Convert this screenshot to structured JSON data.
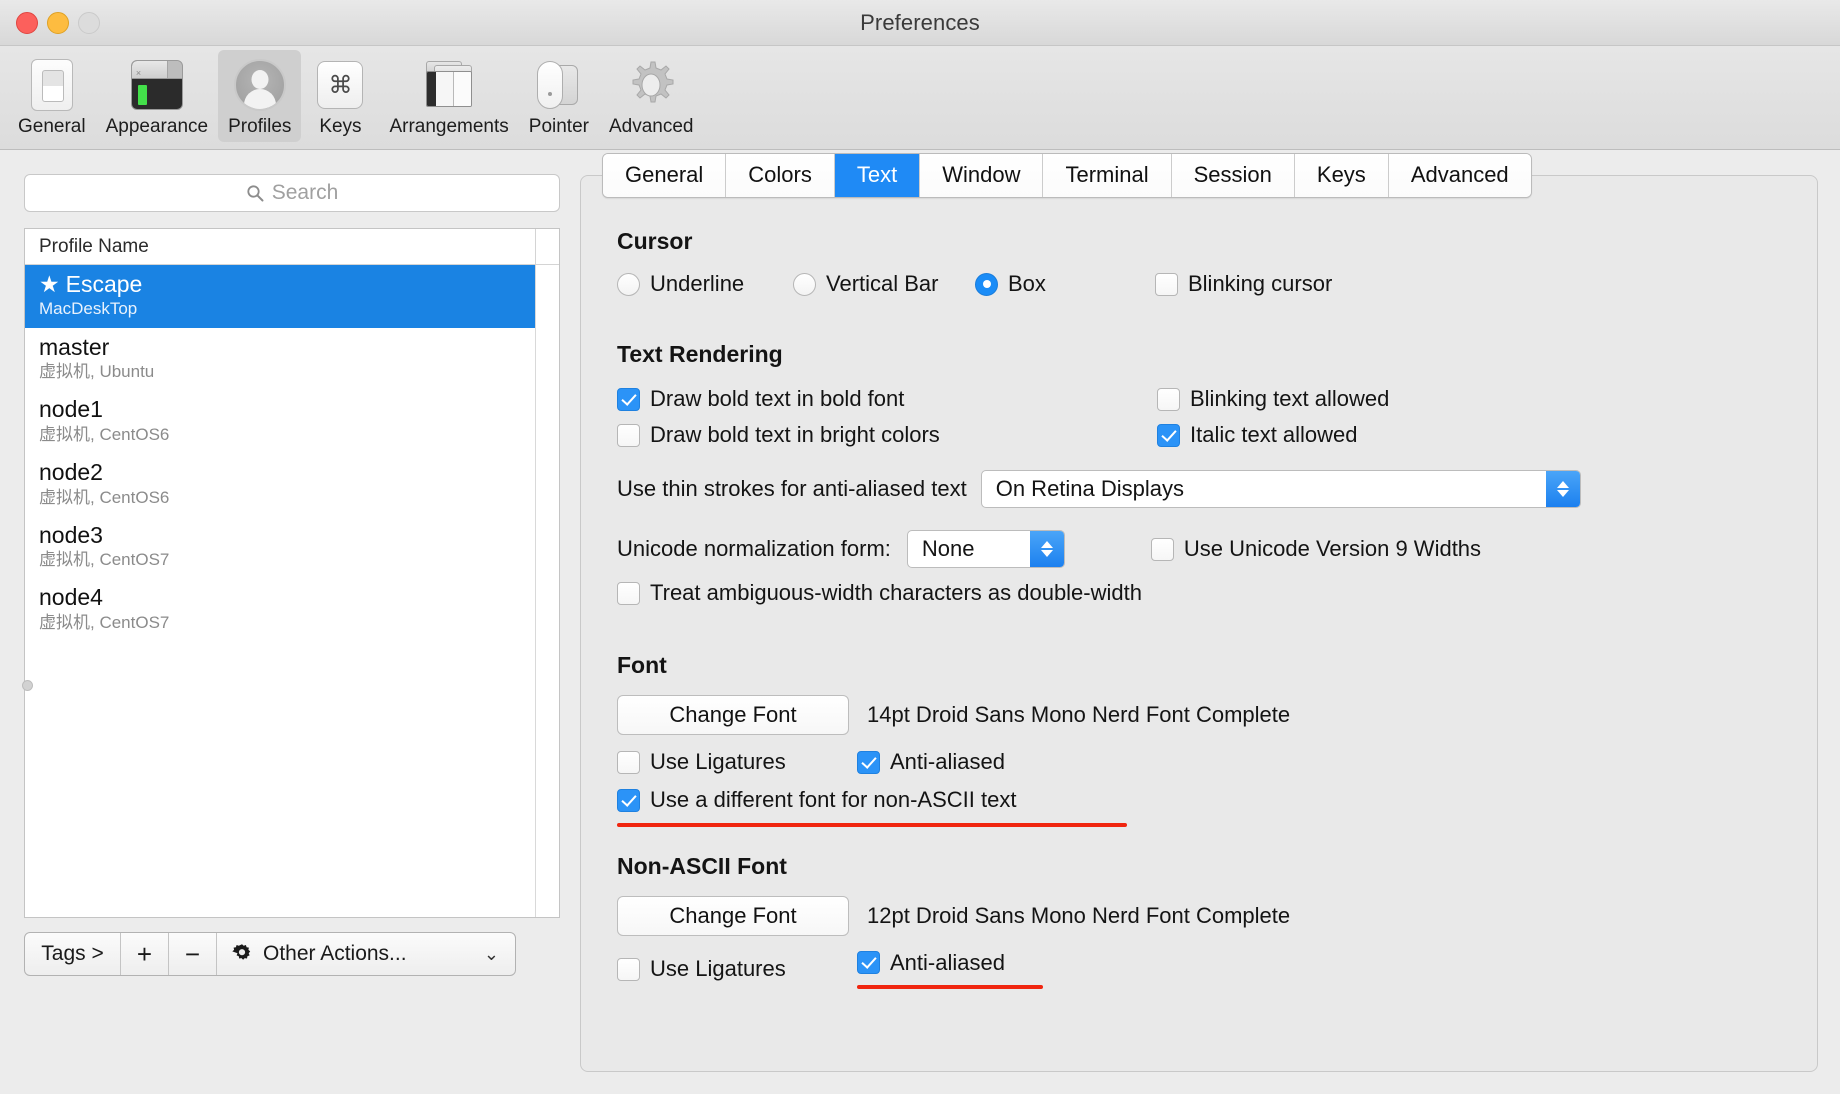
{
  "window": {
    "title": "Preferences"
  },
  "toolbar": {
    "items": [
      {
        "label": "General",
        "icon": "general-icon",
        "selected": false
      },
      {
        "label": "Appearance",
        "icon": "appearance-icon",
        "selected": false
      },
      {
        "label": "Profiles",
        "icon": "profiles-icon",
        "selected": true
      },
      {
        "label": "Keys",
        "icon": "keys-icon",
        "selected": false
      },
      {
        "label": "Arrangements",
        "icon": "arrangements-icon",
        "selected": false
      },
      {
        "label": "Pointer",
        "icon": "pointer-icon",
        "selected": false
      },
      {
        "label": "Advanced",
        "icon": "advanced-icon",
        "selected": false
      }
    ]
  },
  "sidebar": {
    "search": {
      "placeholder": "Search",
      "value": "",
      "icon": "search-icon"
    },
    "list_header": {
      "column": "Profile Name"
    },
    "profiles": [
      {
        "name": "Escape",
        "subtitle": "MacDeskTop",
        "starred": true,
        "star": "★",
        "selected": true
      },
      {
        "name": "master",
        "subtitle": "虚拟机, Ubuntu",
        "starred": false,
        "star": "",
        "selected": false
      },
      {
        "name": "node1",
        "subtitle": "虚拟机, CentOS6",
        "starred": false,
        "star": "",
        "selected": false
      },
      {
        "name": "node2",
        "subtitle": "虚拟机, CentOS6",
        "starred": false,
        "star": "",
        "selected": false
      },
      {
        "name": "node3",
        "subtitle": "虚拟机, CentOS7",
        "starred": false,
        "star": "",
        "selected": false
      },
      {
        "name": "node4",
        "subtitle": "虚拟机, CentOS7",
        "starred": false,
        "star": "",
        "selected": false
      }
    ],
    "bottom_bar": {
      "tags_label": "Tags >",
      "add_label": "+",
      "remove_label": "−",
      "other_actions_label": "Other Actions...",
      "other_actions_icon": "gear-icon",
      "chevron": "⌄"
    }
  },
  "tabs": [
    {
      "label": "General",
      "active": false
    },
    {
      "label": "Colors",
      "active": false
    },
    {
      "label": "Text",
      "active": true
    },
    {
      "label": "Window",
      "active": false
    },
    {
      "label": "Terminal",
      "active": false
    },
    {
      "label": "Session",
      "active": false
    },
    {
      "label": "Keys",
      "active": false
    },
    {
      "label": "Advanced",
      "active": false
    }
  ],
  "text_tab": {
    "cursor": {
      "heading": "Cursor",
      "options": [
        {
          "label": "Underline",
          "selected": false
        },
        {
          "label": "Vertical Bar",
          "selected": false
        },
        {
          "label": "Box",
          "selected": true
        }
      ],
      "blinking_cursor": {
        "label": "Blinking cursor",
        "checked": false
      }
    },
    "text_rendering": {
      "heading": "Text Rendering",
      "draw_bold_bold": {
        "label": "Draw bold text in bold font",
        "checked": true
      },
      "draw_bold_bright": {
        "label": "Draw bold text in bright colors",
        "checked": false
      },
      "blinking_text": {
        "label": "Blinking text allowed",
        "checked": false
      },
      "italic_text": {
        "label": "Italic text allowed",
        "checked": true
      },
      "thin_strokes": {
        "label": "Use thin strokes for anti-aliased text",
        "value": "On Retina Displays"
      },
      "unicode_norm": {
        "label": "Unicode normalization form:",
        "value": "None"
      },
      "unicode_v9": {
        "label": "Use Unicode Version 9 Widths",
        "checked": false
      },
      "ambiguous_width": {
        "label": "Treat ambiguous-width characters as double-width",
        "checked": false
      }
    },
    "font": {
      "heading": "Font",
      "change_font_label": "Change Font",
      "description": "14pt Droid Sans Mono Nerd Font Complete",
      "use_ligatures": {
        "label": "Use Ligatures",
        "checked": false
      },
      "anti_aliased": {
        "label": "Anti-aliased",
        "checked": true
      },
      "different_font_non_ascii": {
        "label": "Use a different font for non-ASCII text",
        "checked": true,
        "highlighted": true
      }
    },
    "non_ascii_font": {
      "heading": "Non-ASCII Font",
      "change_font_label": "Change Font",
      "description": "12pt Droid Sans Mono Nerd Font Complete",
      "use_ligatures": {
        "label": "Use Ligatures",
        "checked": false
      },
      "anti_aliased": {
        "label": "Anti-aliased",
        "checked": true,
        "highlighted": true
      }
    }
  },
  "colors": {
    "accent_blue": "#1f8af5",
    "selection_blue": "#1a83e3",
    "annotation_red": "#f0250f",
    "window_chrome": "#ececec"
  }
}
